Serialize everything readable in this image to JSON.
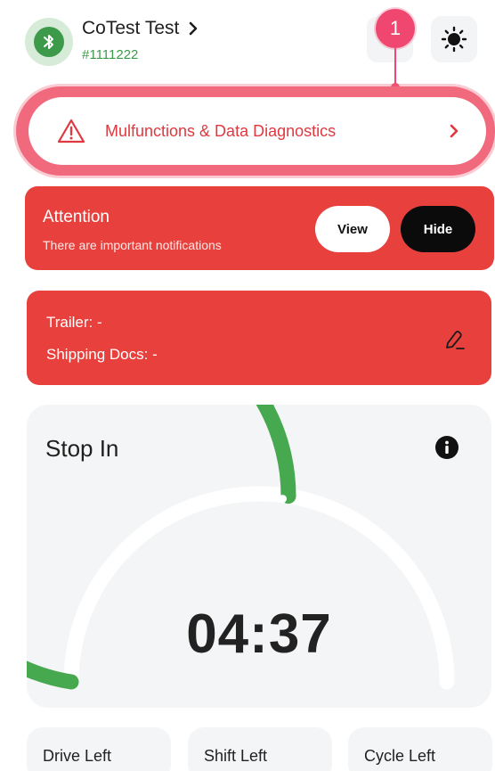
{
  "header": {
    "device_name": "CoTest Test",
    "device_id": "#1111222"
  },
  "annotation": {
    "marker_number": "1"
  },
  "malfunctions": {
    "label": "Mulfunctions & Data Diagnostics"
  },
  "attention": {
    "title": "Attention",
    "subtitle": "There are important notifications",
    "view_label": "View",
    "hide_label": "Hide"
  },
  "trailer": {
    "trailer_text": "Trailer: -",
    "shipping_text": "Shipping Docs: -"
  },
  "stop_in": {
    "title": "Stop In",
    "time": "04:37",
    "progress": 0.55
  },
  "tiles": [
    {
      "label": "Drive Left"
    },
    {
      "label": "Shift Left"
    },
    {
      "label": "Cycle Left"
    }
  ],
  "colors": {
    "accent_green": "#3d9a4a",
    "alert_red": "#e8413d",
    "marker_pink": "#ef476f"
  },
  "icons": {
    "bluetooth": "bluetooth-icon",
    "chevron": "chevron-right-icon",
    "sun": "sun-icon",
    "warning": "warning-icon",
    "edit": "edit-icon",
    "info": "info-icon"
  }
}
